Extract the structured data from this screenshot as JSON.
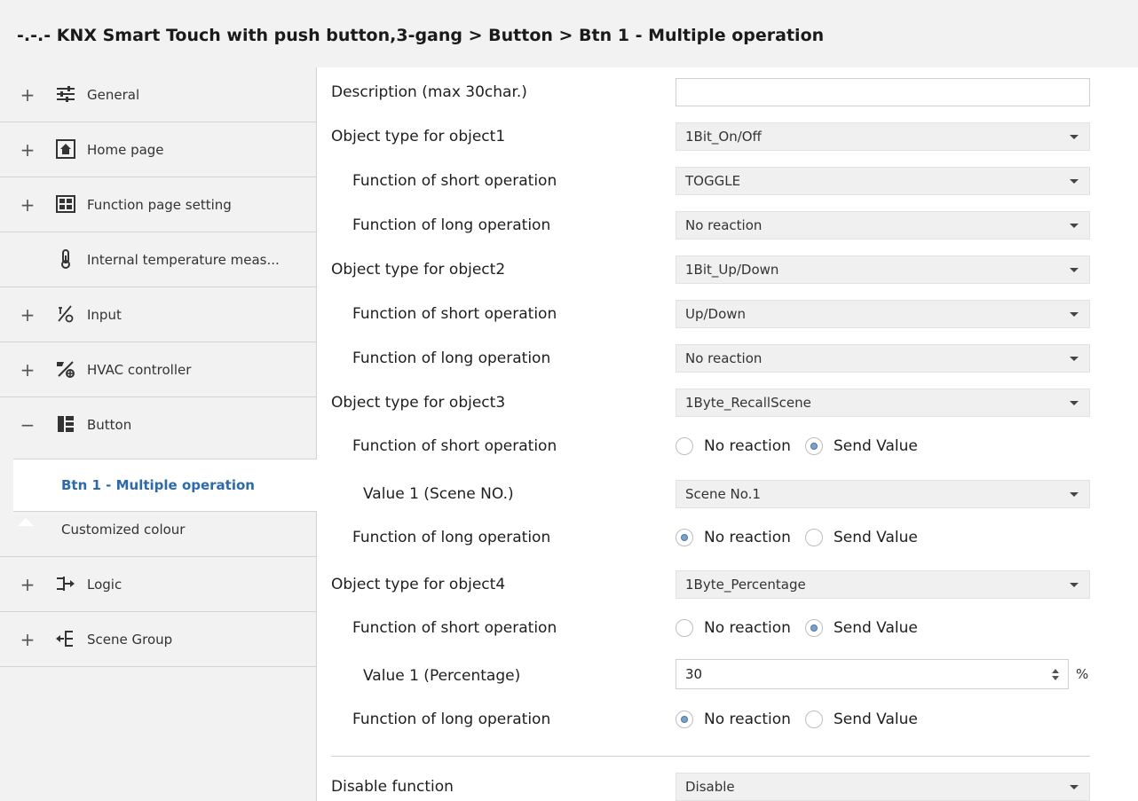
{
  "header": {
    "title": "-.-.- KNX Smart Touch with push button,3-gang > Button > Btn 1 - Multiple operation"
  },
  "sidebar": {
    "items": [
      {
        "expander": "+",
        "icon": "sliders-icon",
        "label": "General"
      },
      {
        "expander": "+",
        "icon": "home-icon",
        "label": "Home page"
      },
      {
        "expander": "+",
        "icon": "grid-icon",
        "label": "Function page setting"
      },
      {
        "expander": "",
        "icon": "thermometer-icon",
        "label": "Internal temperature meas..."
      },
      {
        "expander": "+",
        "icon": "input-icon",
        "label": "Input"
      },
      {
        "expander": "+",
        "icon": "hvac-icon",
        "label": "HVAC controller"
      },
      {
        "expander": "−",
        "icon": "button-icon",
        "label": "Button"
      }
    ],
    "subitems": [
      {
        "label": "Btn 1 - Multiple operation",
        "active": true
      },
      {
        "label": "Customized colour",
        "active": false
      }
    ],
    "items2": [
      {
        "expander": "+",
        "icon": "logic-icon",
        "label": "Logic"
      },
      {
        "expander": "+",
        "icon": "scene-group-icon",
        "label": "Scene Group"
      }
    ]
  },
  "form": {
    "description": {
      "label": "Description (max 30char.)",
      "value": ""
    },
    "obj1_type": {
      "label": "Object type for object1",
      "value": "1Bit_On/Off"
    },
    "obj1_short": {
      "label": "Function of short operation",
      "value": "TOGGLE"
    },
    "obj1_long": {
      "label": "Function of long operation",
      "value": "No reaction"
    },
    "obj2_type": {
      "label": "Object type for object2",
      "value": "1Bit_Up/Down"
    },
    "obj2_short": {
      "label": "Function of short operation",
      "value": "Up/Down"
    },
    "obj2_long": {
      "label": "Function of long operation",
      "value": "No reaction"
    },
    "obj3_type": {
      "label": "Object type for object3",
      "value": "1Byte_RecallScene"
    },
    "obj3_short": {
      "label": "Function of short operation",
      "options": [
        "No reaction",
        "Send Value"
      ],
      "selected": "Send Value"
    },
    "obj3_value": {
      "label": "Value 1 (Scene NO.)",
      "value": "Scene No.1"
    },
    "obj3_long": {
      "label": "Function of long operation",
      "options": [
        "No reaction",
        "Send Value"
      ],
      "selected": "No reaction"
    },
    "obj4_type": {
      "label": "Object type for object4",
      "value": "1Byte_Percentage"
    },
    "obj4_short": {
      "label": "Function of short operation",
      "options": [
        "No reaction",
        "Send Value"
      ],
      "selected": "Send Value"
    },
    "obj4_value": {
      "label": "Value 1 (Percentage)",
      "value": "30",
      "unit": "%"
    },
    "obj4_long": {
      "label": "Function of long operation",
      "options": [
        "No reaction",
        "Send Value"
      ],
      "selected": "No reaction"
    },
    "disable": {
      "label": "Disable function",
      "value": "Disable"
    }
  }
}
